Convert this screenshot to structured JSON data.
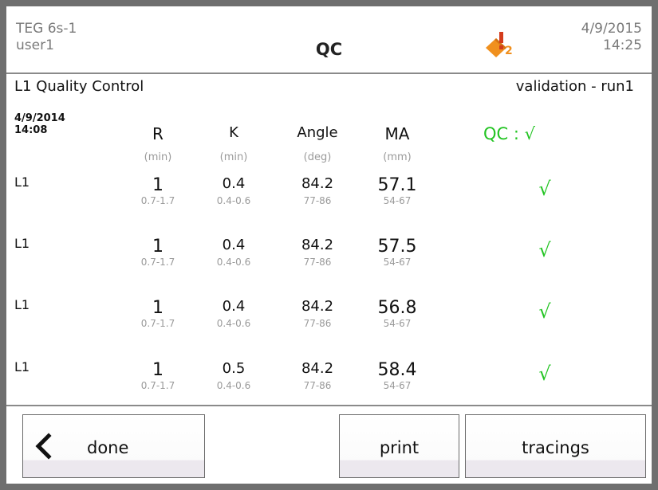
{
  "header": {
    "device": "TEG 6s-1",
    "user": "user1",
    "title": "QC",
    "alert_icon": "cartridge-warning-icon",
    "alert_badge": "2",
    "date": "4/9/2015",
    "time": "14:25",
    "colors": {
      "alert_orange": "#f0901e",
      "alert_red": "#d43c1c"
    }
  },
  "subheader": {
    "left": "L1 Quality Control",
    "right": "validation - run1"
  },
  "table": {
    "date": "4/9/2014",
    "time": "14:08",
    "columns": [
      {
        "name": "R",
        "unit": "(min)"
      },
      {
        "name": "K",
        "unit": "(min)"
      },
      {
        "name": "Angle",
        "unit": "(deg)"
      },
      {
        "name": "MA",
        "unit": "(mm)"
      }
    ],
    "qc_label": "QC : √",
    "rows": [
      {
        "label": "L1",
        "cells": [
          {
            "value": "1",
            "range": "0.7-1.7"
          },
          {
            "value": "0.4",
            "range": "0.4-0.6"
          },
          {
            "value": "84.2",
            "range": "77-86"
          },
          {
            "value": "57.1",
            "range": "54-67"
          }
        ],
        "check": "√"
      },
      {
        "label": "L1",
        "cells": [
          {
            "value": "1",
            "range": "0.7-1.7"
          },
          {
            "value": "0.4",
            "range": "0.4-0.6"
          },
          {
            "value": "84.2",
            "range": "77-86"
          },
          {
            "value": "57.5",
            "range": "54-67"
          }
        ],
        "check": "√"
      },
      {
        "label": "L1",
        "cells": [
          {
            "value": "1",
            "range": "0.7-1.7"
          },
          {
            "value": "0.4",
            "range": "0.4-0.6"
          },
          {
            "value": "84.2",
            "range": "77-86"
          },
          {
            "value": "56.8",
            "range": "54-67"
          }
        ],
        "check": "√"
      },
      {
        "label": "L1",
        "cells": [
          {
            "value": "1",
            "range": "0.7-1.7"
          },
          {
            "value": "0.5",
            "range": "0.4-0.6"
          },
          {
            "value": "84.2",
            "range": "77-86"
          },
          {
            "value": "58.4",
            "range": "54-67"
          }
        ],
        "check": "√"
      }
    ],
    "colors": {
      "pass_green": "#22c422"
    }
  },
  "footer": {
    "done_label": "done",
    "done_icon": "chevron-left-icon",
    "print_label": "print",
    "tracings_label": "tracings"
  }
}
